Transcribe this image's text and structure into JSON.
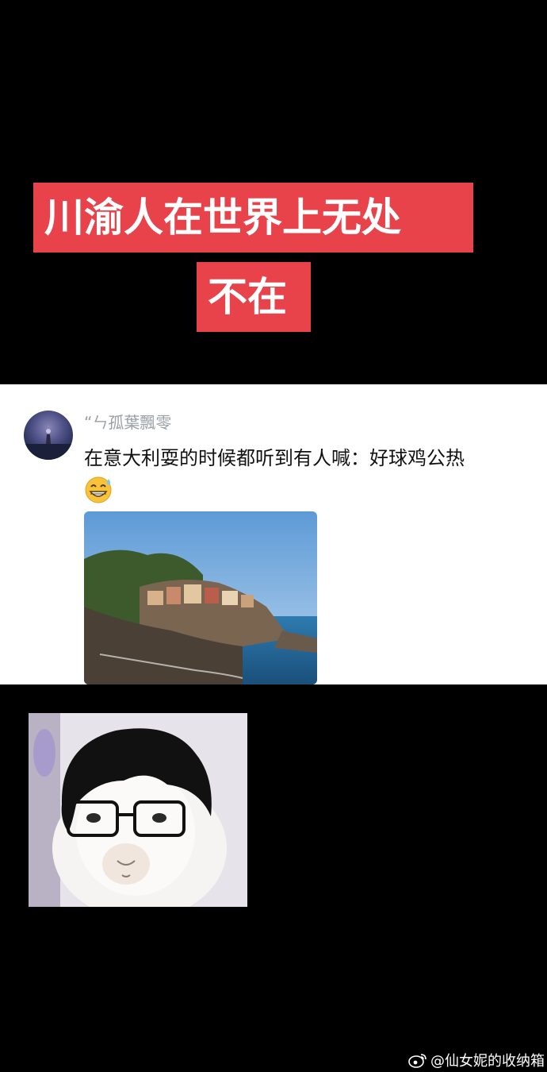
{
  "banner": {
    "line1": "川渝人在世界上无处",
    "line2": "不在"
  },
  "comment": {
    "username": "“ㄣ孤葉飄零",
    "text": "在意大利耍的时候都听到有人喊：好球鸡公热",
    "emoji": "grinning-sweat-emoji",
    "photo": "coastal-cliff-village-photo"
  },
  "meme": "sheep-with-wig-and-glasses-image",
  "watermark": {
    "text": "@仙女妮的收纳箱",
    "icon": "weibo-icon"
  },
  "colors": {
    "banner_bg": "#e8434a",
    "banner_text": "#ffffff",
    "background": "#000000",
    "card_bg": "#ffffff"
  }
}
